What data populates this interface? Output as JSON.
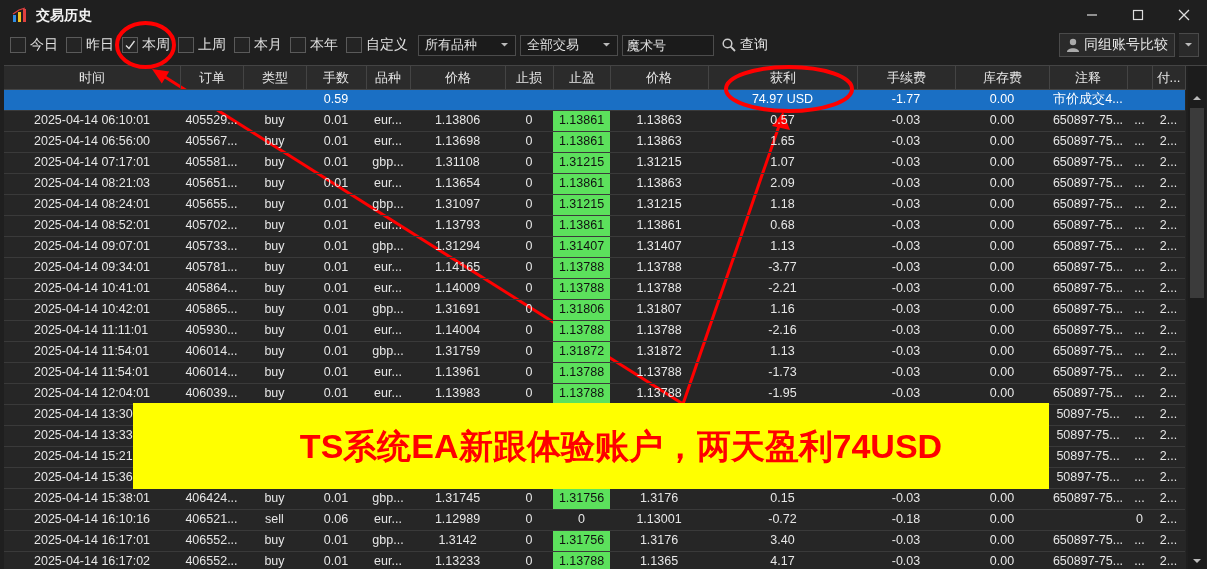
{
  "window": {
    "title": "交易历史"
  },
  "filters": [
    {
      "label": "今日",
      "checked": false
    },
    {
      "label": "昨日",
      "checked": false
    },
    {
      "label": "本周",
      "checked": true
    },
    {
      "label": "上周",
      "checked": false
    },
    {
      "label": "本月",
      "checked": false
    },
    {
      "label": "本年",
      "checked": false
    },
    {
      "label": "自定义",
      "checked": false
    }
  ],
  "dropdowns": [
    {
      "value": "所有品种"
    },
    {
      "value": "全部交易"
    }
  ],
  "magic_field": {
    "placeholder": "魔术号"
  },
  "query_button": {
    "label": "查询"
  },
  "compare_button": {
    "label": "同组账号比较"
  },
  "table": {
    "columns": [
      {
        "label": "时间"
      },
      {
        "label": "订单"
      },
      {
        "label": "类型"
      },
      {
        "label": "手数"
      },
      {
        "label": "品种"
      },
      {
        "label": "价格"
      },
      {
        "label": "止损"
      },
      {
        "label": "止盈"
      },
      {
        "label": "价格"
      },
      {
        "label": "获利"
      },
      {
        "label": "手续费"
      },
      {
        "label": "库存费"
      },
      {
        "label": "注释"
      },
      {},
      {
        "label": "付..."
      }
    ],
    "summary_row": {
      "selected": true,
      "cells": [
        null,
        null,
        null,
        "0.59",
        null,
        null,
        null,
        null,
        null,
        "74.97 USD",
        "-1.77",
        "0.00",
        "市价成交4...",
        null,
        null
      ]
    },
    "rows": [
      {
        "selected": false,
        "tp_hit": true,
        "cells": [
          "2025-04-14 06:10:01",
          "405529...",
          "buy",
          "0.01",
          "eur...",
          "1.13806",
          "0",
          "1.13861",
          "1.13863",
          "0.57",
          "-0.03",
          "0.00",
          "650897-75...",
          "...",
          "2..."
        ]
      },
      {
        "selected": false,
        "tp_hit": true,
        "cells": [
          "2025-04-14 06:56:00",
          "405567...",
          "buy",
          "0.01",
          "eur...",
          "1.13698",
          "0",
          "1.13861",
          "1.13863",
          "1.65",
          "-0.03",
          "0.00",
          "650897-75...",
          "...",
          "2..."
        ]
      },
      {
        "selected": false,
        "tp_hit": true,
        "cells": [
          "2025-04-14 07:17:01",
          "405581...",
          "buy",
          "0.01",
          "gbp...",
          "1.31108",
          "0",
          "1.31215",
          "1.31215",
          "1.07",
          "-0.03",
          "0.00",
          "650897-75...",
          "...",
          "2..."
        ]
      },
      {
        "selected": false,
        "tp_hit": true,
        "cells": [
          "2025-04-14 08:21:03",
          "405651...",
          "buy",
          "0.01",
          "eur...",
          "1.13654",
          "0",
          "1.13861",
          "1.13863",
          "2.09",
          "-0.03",
          "0.00",
          "650897-75...",
          "...",
          "2..."
        ]
      },
      {
        "selected": false,
        "tp_hit": true,
        "cells": [
          "2025-04-14 08:24:01",
          "405655...",
          "buy",
          "0.01",
          "gbp...",
          "1.31097",
          "0",
          "1.31215",
          "1.31215",
          "1.18",
          "-0.03",
          "0.00",
          "650897-75...",
          "...",
          "2..."
        ]
      },
      {
        "selected": false,
        "tp_hit": true,
        "cells": [
          "2025-04-14 08:52:01",
          "405702...",
          "buy",
          "0.01",
          "eur...",
          "1.13793",
          "0",
          "1.13861",
          "1.13861",
          "0.68",
          "-0.03",
          "0.00",
          "650897-75...",
          "...",
          "2..."
        ]
      },
      {
        "selected": false,
        "tp_hit": true,
        "cells": [
          "2025-04-14 09:07:01",
          "405733...",
          "buy",
          "0.01",
          "gbp...",
          "1.31294",
          "0",
          "1.31407",
          "1.31407",
          "1.13",
          "-0.03",
          "0.00",
          "650897-75...",
          "...",
          "2..."
        ]
      },
      {
        "selected": false,
        "tp_hit": true,
        "cells": [
          "2025-04-14 09:34:01",
          "405781...",
          "buy",
          "0.01",
          "eur...",
          "1.14165",
          "0",
          "1.13788",
          "1.13788",
          "-3.77",
          "-0.03",
          "0.00",
          "650897-75...",
          "...",
          "2..."
        ]
      },
      {
        "selected": false,
        "tp_hit": true,
        "cells": [
          "2025-04-14 10:41:01",
          "405864...",
          "buy",
          "0.01",
          "eur...",
          "1.14009",
          "0",
          "1.13788",
          "1.13788",
          "-2.21",
          "-0.03",
          "0.00",
          "650897-75...",
          "...",
          "2..."
        ]
      },
      {
        "selected": false,
        "tp_hit": true,
        "cells": [
          "2025-04-14 10:42:01",
          "405865...",
          "buy",
          "0.01",
          "gbp...",
          "1.31691",
          "0",
          "1.31806",
          "1.31807",
          "1.16",
          "-0.03",
          "0.00",
          "650897-75...",
          "...",
          "2..."
        ]
      },
      {
        "selected": false,
        "tp_hit": true,
        "cells": [
          "2025-04-14 11:11:01",
          "405930...",
          "buy",
          "0.01",
          "eur...",
          "1.14004",
          "0",
          "1.13788",
          "1.13788",
          "-2.16",
          "-0.03",
          "0.00",
          "650897-75...",
          "...",
          "2..."
        ]
      },
      {
        "selected": false,
        "tp_hit": true,
        "cells": [
          "2025-04-14 11:54:01",
          "406014...",
          "buy",
          "0.01",
          "gbp...",
          "1.31759",
          "0",
          "1.31872",
          "1.31872",
          "1.13",
          "-0.03",
          "0.00",
          "650897-75...",
          "...",
          "2..."
        ]
      },
      {
        "selected": false,
        "tp_hit": true,
        "cells": [
          "2025-04-14 11:54:01",
          "406014...",
          "buy",
          "0.01",
          "eur...",
          "1.13961",
          "0",
          "1.13788",
          "1.13788",
          "-1.73",
          "-0.03",
          "0.00",
          "650897-75...",
          "...",
          "2..."
        ]
      },
      {
        "selected": false,
        "tp_hit": true,
        "cells": [
          "2025-04-14 12:04:01",
          "406039...",
          "buy",
          "0.01",
          "eur...",
          "1.13983",
          "0",
          "1.13788",
          "1.13788",
          "-1.95",
          "-0.03",
          "0.00",
          "650897-75...",
          "...",
          "2..."
        ]
      },
      {
        "cells": [
          "2025-04-14 13:30",
          null,
          null,
          null,
          null,
          null,
          null,
          null,
          null,
          null,
          null,
          null,
          "50897-75...",
          "...",
          "2..."
        ]
      },
      {
        "cells": [
          "2025-04-14 13:33",
          null,
          null,
          null,
          null,
          null,
          null,
          null,
          null,
          null,
          null,
          null,
          "50897-75...",
          "...",
          "2..."
        ]
      },
      {
        "cells": [
          "2025-04-14 15:21",
          null,
          null,
          null,
          null,
          null,
          null,
          null,
          null,
          null,
          null,
          null,
          "50897-75...",
          "...",
          "2..."
        ]
      },
      {
        "cells": [
          "2025-04-14 15:36",
          null,
          null,
          null,
          null,
          null,
          null,
          null,
          null,
          null,
          null,
          null,
          "50897-75...",
          "...",
          "2..."
        ]
      },
      {
        "selected": false,
        "tp_hit": true,
        "cells": [
          "2025-04-14 15:38:01",
          "406424...",
          "buy",
          "0.01",
          "gbp...",
          "1.31745",
          "0",
          "1.31756",
          "1.3176",
          "0.15",
          "-0.03",
          "0.00",
          "650897-75...",
          "...",
          "2..."
        ]
      },
      {
        "selected": false,
        "tp_hit": false,
        "cells": [
          "2025-04-14 16:10:16",
          "406521...",
          "sell",
          "0.06",
          "eur...",
          "1.12989",
          "0",
          "0",
          "1.13001",
          "-0.72",
          "-0.18",
          "0.00",
          null,
          "0",
          "2..."
        ]
      },
      {
        "selected": false,
        "tp_hit": true,
        "cells": [
          "2025-04-14 16:17:01",
          "406552...",
          "buy",
          "0.01",
          "gbp...",
          "1.3142",
          "0",
          "1.31756",
          "1.3176",
          "3.40",
          "-0.03",
          "0.00",
          "650897-75...",
          "...",
          "2..."
        ]
      },
      {
        "selected": false,
        "tp_hit": true,
        "cells": [
          "2025-04-14 16:17:02",
          "406552...",
          "buy",
          "0.01",
          "eur...",
          "1.13233",
          "0",
          "1.13788",
          "1.1365",
          "4.17",
          "-0.03",
          "0.00",
          "650897-75...",
          "...",
          "2..."
        ]
      }
    ]
  },
  "banner": {
    "text": "TS系统EA新跟体验账户，两天盈利74USD"
  }
}
